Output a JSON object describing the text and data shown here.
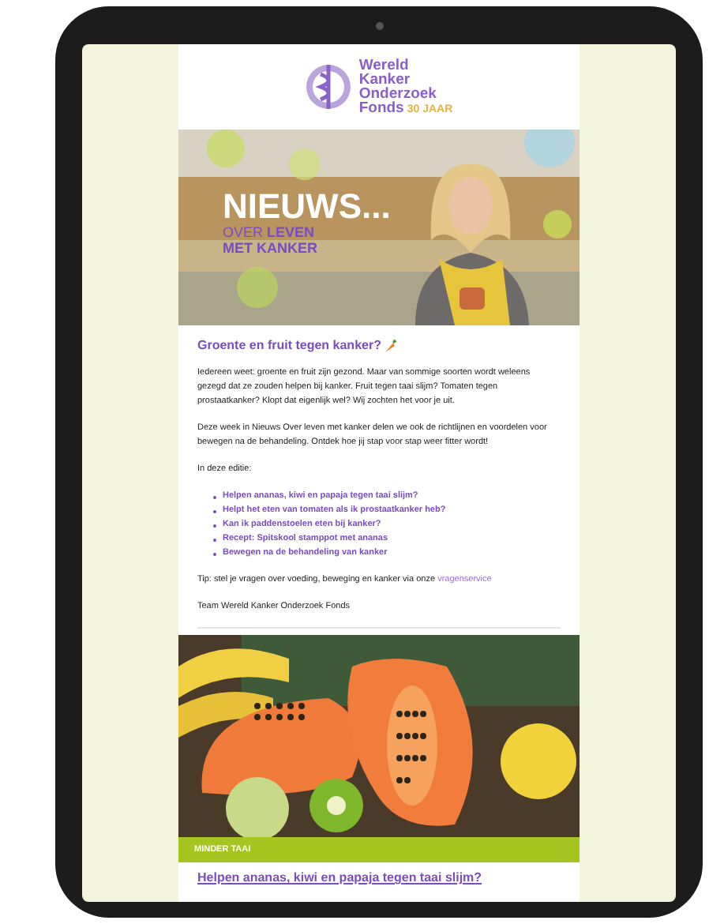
{
  "logo": {
    "lines": [
      "Wereld",
      "Kanker",
      "Onderzoek",
      "Fonds"
    ],
    "badge": "30 JAAR"
  },
  "hero": {
    "title": "NIEUWS...",
    "subtitle": "OVER **LEVEN** **MET KANKER**"
  },
  "article": {
    "title": "Groente en fruit tegen kanker?",
    "paragraphs": [
      "Iedereen weet: groente en fruit zijn gezond. Maar van sommige soorten wordt weleens gezegd dat ze zouden helpen bij kanker. Fruit tegen taai slijm? Tomaten tegen prostaatkanker? Klopt dat eigenlijk wel? Wij zochten het voor je uit.",
      "Deze week in Nieuws Over leven met kanker delen we ook de richtlijnen en voordelen voor bewegen na de behandeling. Ontdek hoe jij stap voor stap weer fitter wordt!",
      "In deze editie:"
    ],
    "bullets": [
      "Helpen ananas, kiwi en papaja tegen taai slijm?",
      "Helpt het eten van tomaten als ik prostaatkanker heb?",
      "Kan ik paddenstoelen eten bij kanker?",
      "Recept: Spitskool stamppot met ananas",
      "Bewegen na de behandeling van kanker"
    ],
    "tip": {
      "text": "Tip: stel je vragen over voeding, beweging en kanker via onze",
      "link": "vragenservice"
    },
    "signature": "Team Wereld Kanker Onderzoek Fonds"
  },
  "section": {
    "label": "MINDER TAAI",
    "headline": "Helpen ananas, kiwi en papaja tegen taai slijm?"
  }
}
